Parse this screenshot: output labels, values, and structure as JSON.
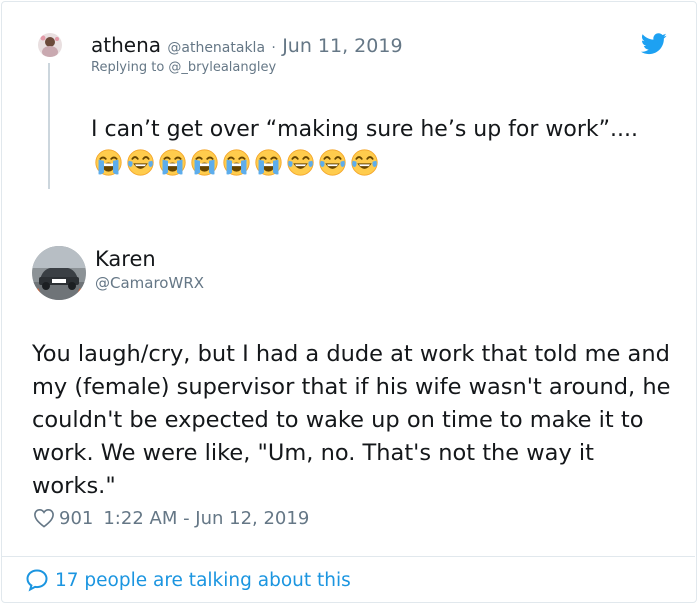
{
  "parent_tweet": {
    "display_name": "athena",
    "handle": "@athenatakla",
    "separator": "·",
    "date": "Jun 11, 2019",
    "replying_to": "Replying to @_brylealangley",
    "text": "I can’t get over “making sure he’s up for work”....",
    "emojis": [
      "loudly-crying-face-emoji",
      "face-with-tears-of-joy-emoji",
      "loudly-crying-face-emoji",
      "loudly-crying-face-emoji",
      "loudly-crying-face-emoji",
      "loudly-crying-face-emoji",
      "face-with-tears-of-joy-emoji",
      "face-with-tears-of-joy-emoji",
      "face-with-tears-of-joy-emoji"
    ]
  },
  "main_tweet": {
    "display_name": "Karen",
    "handle": "@CamaroWRX",
    "text": "You laugh/cry, but I had a dude at work that told me and my (female) supervisor that if his wife wasn't around, he couldn't be expected to wake up on time to make it to work. We were like, \"Um, no. That's not the way it works.\"",
    "like_count": "901",
    "timestamp": "1:22 AM - Jun 12, 2019"
  },
  "footer": {
    "conversation_label": "17 people are talking about this"
  },
  "colors": {
    "brand_blue": "#1da1f2",
    "link_blue": "#1b95e0",
    "muted_text": "#657786",
    "primary_text": "#14171a",
    "border": "#e1e8ed"
  },
  "icons": {
    "brand": "twitter-bird-icon",
    "like": "heart-outline-icon",
    "conversation": "speech-bubble-icon"
  }
}
